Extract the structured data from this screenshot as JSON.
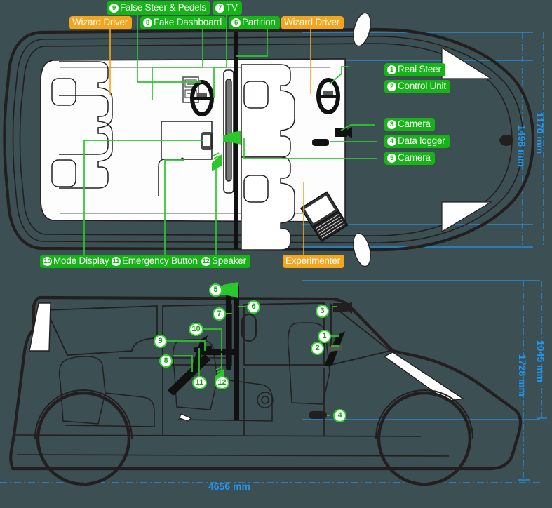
{
  "diagram": {
    "title": "Wizard-of-Oz driving simulator vehicle layout",
    "views": [
      "top-view",
      "side-view"
    ],
    "colors": {
      "background": "#3c4f52",
      "green_label": "#16b516",
      "orange_label": "#f5a51c",
      "dimension_blue": "#2196f3",
      "body_outline": "#231f20"
    }
  },
  "top_labels": [
    {
      "id": "wizard-driver-left",
      "num": "",
      "text": "Wizard Driver",
      "color": "orange"
    },
    {
      "id": "false-steer-pedels",
      "num": "9",
      "text": "False Steer & Pedels",
      "color": "green"
    },
    {
      "id": "tv",
      "num": "7",
      "text": "TV",
      "color": "green"
    },
    {
      "id": "fake-dashboard",
      "num": "8",
      "text": "Fake Dashboard",
      "color": "green"
    },
    {
      "id": "partition",
      "num": "6",
      "text": "Partition",
      "color": "green"
    },
    {
      "id": "wizard-driver-right",
      "num": "",
      "text": "Wizard Driver",
      "color": "orange"
    }
  ],
  "right_labels": [
    {
      "id": "real-steer",
      "num": "1",
      "text": "Real Steer",
      "color": "green"
    },
    {
      "id": "control-unit",
      "num": "2",
      "text": "Control Unit",
      "color": "green"
    },
    {
      "id": "camera-3",
      "num": "3",
      "text": "Camera",
      "color": "green"
    },
    {
      "id": "data-logger",
      "num": "4",
      "text": "Data logger",
      "color": "green"
    },
    {
      "id": "camera-5",
      "num": "5",
      "text": "Camera",
      "color": "green"
    }
  ],
  "bottom_labels": [
    {
      "id": "mode-display",
      "num": "10",
      "text": "Mode Display",
      "color": "green"
    },
    {
      "id": "emergency-button",
      "num": "11",
      "text": "Emergency Button",
      "color": "green"
    },
    {
      "id": "speaker",
      "num": "12",
      "text": "Speaker",
      "color": "green"
    },
    {
      "id": "experimenter",
      "num": "",
      "text": "Experimenter",
      "color": "orange"
    }
  ],
  "side_callouts": [
    {
      "id": "callout-5",
      "num": "5"
    },
    {
      "id": "callout-6",
      "num": "6"
    },
    {
      "id": "callout-7",
      "num": "7"
    },
    {
      "id": "callout-10",
      "num": "10"
    },
    {
      "id": "callout-9",
      "num": "9"
    },
    {
      "id": "callout-8",
      "num": "8"
    },
    {
      "id": "callout-11",
      "num": "11"
    },
    {
      "id": "callout-12",
      "num": "12"
    },
    {
      "id": "callout-3",
      "num": "3"
    },
    {
      "id": "callout-1",
      "num": "1"
    },
    {
      "id": "callout-2",
      "num": "2"
    },
    {
      "id": "callout-4",
      "num": "4"
    }
  ],
  "dimensions": {
    "top_inner_width": "1170 mm",
    "top_outer_width": "1498 mm",
    "side_inner_height": "1045 mm",
    "side_outer_height": "1728 mm",
    "length": "4656 mm"
  }
}
